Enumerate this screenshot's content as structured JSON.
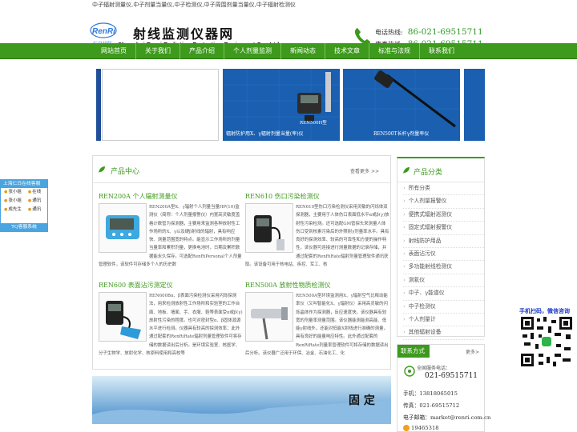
{
  "topline": "中子辐射测量仪,中子剂量当量仪,中子检测仪,中子周围剂量当量仪,中子辐射检测仪",
  "header": {
    "logo_brand": "RenRi",
    "logo_sub": "仁日核防",
    "title_cn": "射线监测仪器网",
    "title_en": "Shanghai Renri Radiation Protection Equipment Co., Ltd.",
    "hotline_label": "电话热线:",
    "hotline_num": "86-021-69515711",
    "fax_label": "传真热线:",
    "fax_num": "86-021-69515711"
  },
  "nav": [
    "网站首页",
    "关于我们",
    "产品介绍",
    "个人剂量监测",
    "新闻动态",
    "技术文章",
    "标准与法规",
    "联系我们"
  ],
  "banner": {
    "slide2_label": "REN500H型",
    "slide2_caption": "辐射防护用X、γ辐射剂量当量(率)仪",
    "slide3_caption": "REN500T长杆γ剂量率仪"
  },
  "products": {
    "title": "产品中心",
    "more": "查看更多 >>",
    "items": [
      {
        "name": "REN200A 个人辐射测量仪",
        "desc": "REN200A型X、γ辐射个人剂量当量HP(10)监测仪（简称：个人剂量报警仪）内置高灵敏度盖格计数管为探测器，主要用来监测各种放射性工作场所的X、γ以及硬β射线的辐射，具有响应快、测量范围宽的特点。能显示工作场所的剂量当量率和累积剂量，更换电池时，日期及累积数据能永久保存。可选配RenRiPersonal个人剂量管理软件，该软件可存储多个人的历史数"
      },
      {
        "name": "REN610 伤口污染检测仪",
        "desc": "REN610型伤口污染检测仪采用灵敏的闪烁体双探测器，主要用于人体伤口表面低水平α或β(γ)放射性污染检测。还可选配GM管探头来测量人体伤口受到核素污染后的外照射γ剂量率水平。具有良好的探测效率、较高的可靠性和方便的操作特性，该仪器可连接进行测量数据的记录存储，并通过配套的RenRiRate辐射剂量管理软件通讯获取。该设备可用于核电站、疾控、军工、核"
      },
      {
        "name": "REN600 表面沾污测定仪",
        "desc": "REN600Bα、β表面污染检测仪采用闪烁探测法，用来检测放射性工作场所和实验室的工作台面、地板、墙面、手、衣服、鞋等表面受α或β(γ)放射性污染的程度。也可对密封型α、β固体源源水平进行检测。仪器具有较高的探测效率；此外通过配套的RenRiRate辐射剂量管理软件可将存储的数据读出后分析。是环境实验室、核医学、分子生物学、放射化学、核原料使用和高校等"
      },
      {
        "name": "REN500A 放射性物质检测仪",
        "desc": "REN500A型环境监测用X、γ辐射空气比释动能率仪（又叫智能化X、γ辐射仪）采用高灵敏的闪烁晶体作为探测器，反应速度快。该仪器具有较宽的剂量率测量范围。该仪器能测能测高能、低能γ射线外，还能对低能X射线进行准确的测量，具有良好的能量响应特性。此外通过配套的RenRiRate剂量率管理软件可将存储的数据读出后分析。该仪器广泛用于环保、冶金、石油化工、化"
      }
    ]
  },
  "bottom_banner_text": "固 定",
  "categories": {
    "title": "产品分类",
    "items": [
      "所有分类",
      "个人剂量报警仪",
      "便携式辐射巡测仪",
      "固定式辐射报警仪",
      "射线防护用品",
      "表面沾污仪",
      "多功能射线检测仪",
      "测氡仪",
      "中子、γ能谱仪",
      "中子检测仪",
      "个人剂量计",
      "其他辐射设备"
    ]
  },
  "contact": {
    "title": "联系方式",
    "more": "更多>",
    "service_label": "全国服务电话：",
    "service_num": "021-69515711",
    "mobile": "手机：13818065015",
    "tel": "传真：021-69515712",
    "email": "电子邮箱：market@renri.com.cn",
    "qq": "19465318"
  },
  "online_service": {
    "title": "上海仁日在线客服",
    "agents": [
      [
        "张小姐",
        "在线"
      ],
      [
        "张小姐",
        "通讯"
      ],
      [
        "成先生",
        "通讯"
      ]
    ],
    "footer": "TQ客服系统"
  },
  "qr": {
    "title": "手机扫码，微信咨询"
  },
  "colors": {
    "brand_green": "#3d9a1c",
    "phone_green": "#2f9a25",
    "qr_blue": "#1b39c8"
  }
}
